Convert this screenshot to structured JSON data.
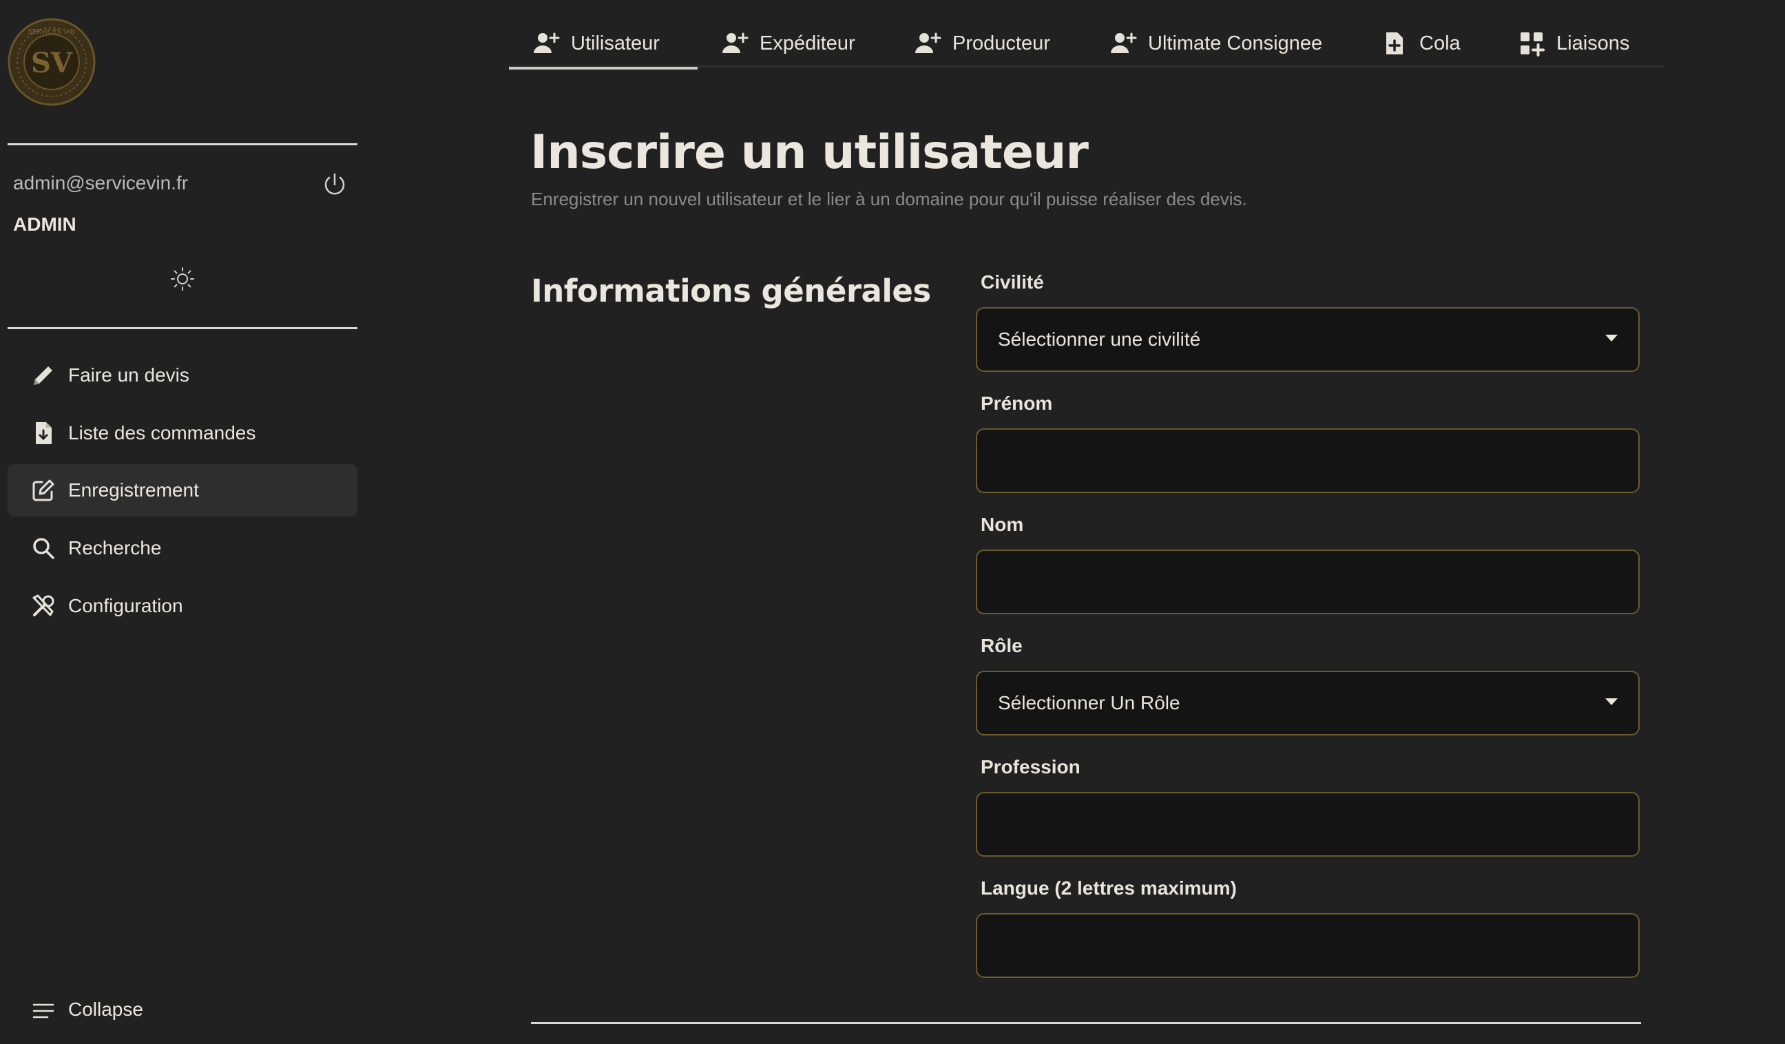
{
  "colors": {
    "background": "#212121",
    "accent_gold": "#6b5a2c",
    "text": "#e9e4dc",
    "muted": "#8d8a86"
  },
  "sidebar": {
    "logo_icon": "services-vin-seal-logo",
    "logo_text": "SERVICES VIN",
    "user": {
      "email": "admin@servicevin.fr",
      "role": "ADMIN"
    },
    "logout_icon": "power-icon",
    "theme_icon": "sun-icon",
    "items": [
      {
        "label": "Faire un devis",
        "icon": "pencil-icon",
        "active": false
      },
      {
        "label": "Liste des commandes",
        "icon": "file-download-icon",
        "active": false
      },
      {
        "label": "Enregistrement",
        "icon": "edit-square-icon",
        "active": true
      },
      {
        "label": "Recherche",
        "icon": "search-icon",
        "active": false
      },
      {
        "label": "Configuration",
        "icon": "tools-icon",
        "active": false
      }
    ],
    "collapse": {
      "label": "Collapse",
      "icon": "menu-lines-icon"
    }
  },
  "tabs": [
    {
      "label": "Utilisateur",
      "icon": "user-plus-icon",
      "active": true
    },
    {
      "label": "Expéditeur",
      "icon": "user-plus-icon",
      "active": false
    },
    {
      "label": "Producteur",
      "icon": "user-plus-icon",
      "active": false
    },
    {
      "label": "Ultimate Consignee",
      "icon": "user-plus-icon",
      "active": false
    },
    {
      "label": "Cola",
      "icon": "file-plus-icon",
      "active": false
    },
    {
      "label": "Liaisons",
      "icon": "grid-plus-icon",
      "active": false
    }
  ],
  "main": {
    "title": "Inscrire un utilisateur",
    "subtitle": "Enregistrer un nouvel utilisateur et le lier à un domaine pour qu'il puisse réaliser des devis.",
    "section_title": "Informations générales",
    "fields": {
      "civilite": {
        "label": "Civilité",
        "value": "Sélectionner une civilité"
      },
      "prenom": {
        "label": "Prénom",
        "value": ""
      },
      "nom": {
        "label": "Nom",
        "value": ""
      },
      "role": {
        "label": "Rôle",
        "value": "Sélectionner Un Rôle"
      },
      "profession": {
        "label": "Profession",
        "value": ""
      },
      "langue": {
        "label": "Langue (2 lettres maximum)",
        "value": ""
      }
    }
  }
}
